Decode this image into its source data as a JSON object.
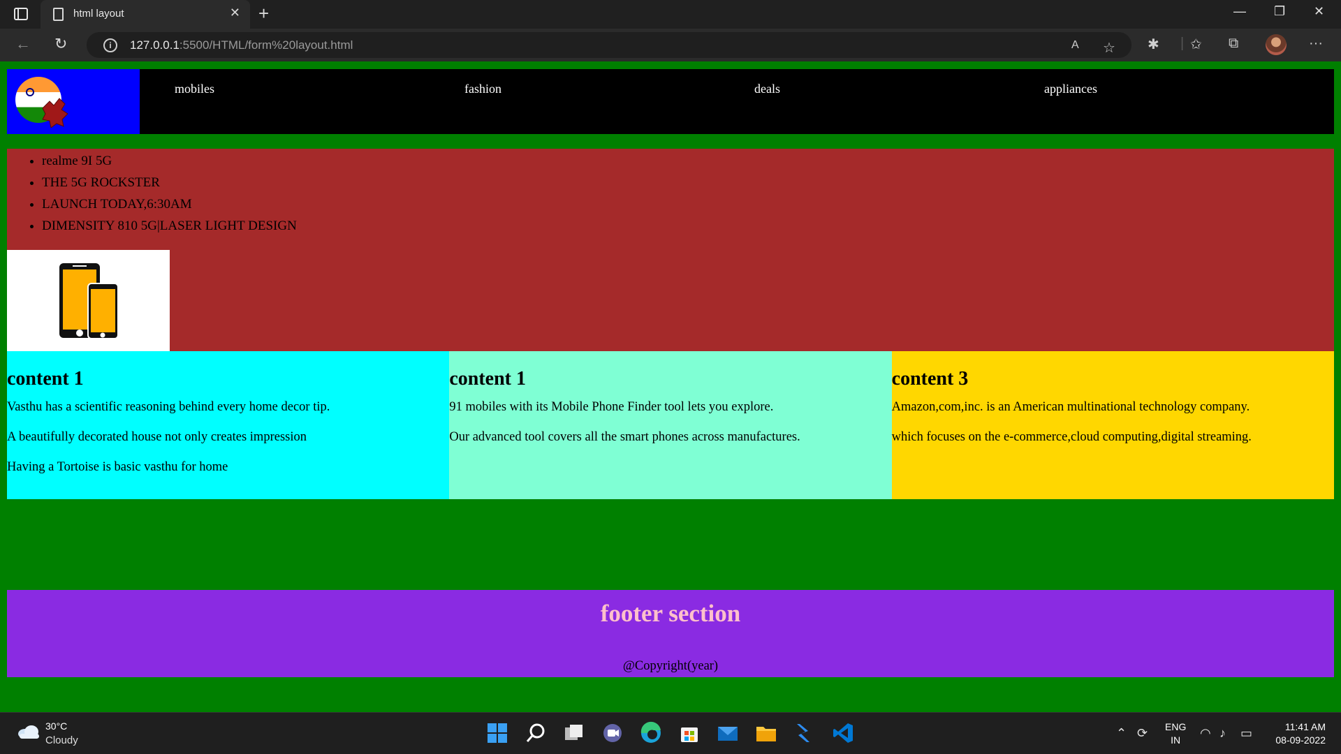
{
  "browser": {
    "tab_title": "html layout",
    "tab_close": "✕",
    "new_tab": "+",
    "url_host": "127.0.0.1",
    "url_rest": ":5500/HTML/form%20layout.html",
    "window_controls": [
      "—",
      "❐",
      "✕"
    ]
  },
  "page": {
    "nav": [
      "mobiles",
      "fashion",
      "deals",
      "appliances"
    ],
    "banner_items": [
      "realme 9I 5G",
      "THE 5G ROCKSTER",
      "LAUNCH TODAY,6:30AM",
      "DIMENSITY 810 5G|LASER LIGHT DESIGN"
    ],
    "columns": [
      {
        "heading": "content 1",
        "color": "#00ffff",
        "paragraphs": [
          "Vasthu has a scientific reasoning behind every home decor tip.",
          "A beautifully decorated house not only creates impression",
          "Having a Tortoise is basic vasthu for home"
        ]
      },
      {
        "heading": "content 1",
        "color": "#7fffd4",
        "paragraphs": [
          "91 mobiles with its Mobile Phone Finder tool lets you explore.",
          "Our advanced tool covers all the smart phones across manufactures."
        ]
      },
      {
        "heading": "content 3",
        "color": "#ffd700",
        "paragraphs": [
          "Amazon,com,inc. is an American multinational technology company.",
          "which focuses on the e-commerce,cloud computing,digital streaming."
        ]
      }
    ],
    "footer": {
      "title": "footer section",
      "copyright": "@Copyright(year)"
    },
    "colors": {
      "page_bg": "#008000",
      "header_bg": "#000000",
      "logo_bg": "#0000ff",
      "banner_bg": "#a52a2a",
      "footer_bg": "#8a2be2",
      "footer_title": "#ffc0cb"
    }
  },
  "taskbar": {
    "temperature": "30°C",
    "weather": "Cloudy",
    "lang": "ENG",
    "region": "IN",
    "time": "11:41 AM",
    "date": "08-09-2022"
  }
}
